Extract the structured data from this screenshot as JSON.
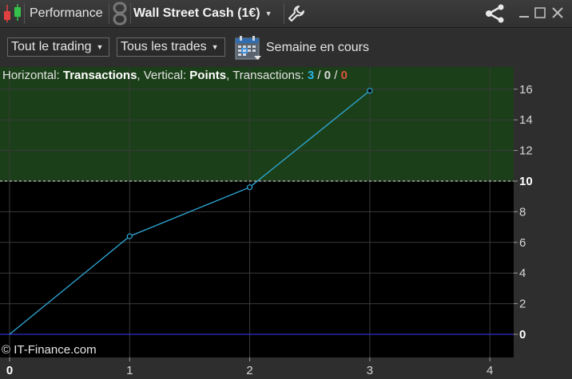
{
  "titlebar": {
    "title": "Performance",
    "instrument": "Wall Street Cash (1€)"
  },
  "toolbar": {
    "trading_filter": "Tout le trading",
    "trades_filter": "Tous les trades",
    "period": "Semaine en cours"
  },
  "info": {
    "horizontal_label": "Horizontal:",
    "horizontal_value": "Transactions",
    "vertical_label": ", Vertical:",
    "vertical_value": "Points",
    "transactions_label": ", Transactions:",
    "count_winning": "3",
    "slash1": " / ",
    "count_neutral": "0",
    "slash2": " / ",
    "count_losing": "0"
  },
  "copyright": "© IT-Finance.com",
  "colors": {
    "positive_zone": "#1b3f18",
    "line": "#2fa8d8",
    "zero_line": "#2d2dd0",
    "background": "#000000"
  },
  "icons": [
    "candlestick-icon",
    "link-icon",
    "wrench-icon",
    "share-icon",
    "minimize-icon",
    "maximize-icon",
    "close-icon",
    "calendar-icon"
  ],
  "chart_data": {
    "type": "line",
    "x": [
      0,
      1,
      2,
      3
    ],
    "y": [
      0,
      6.4,
      9.6,
      15.9
    ],
    "xlim": [
      0,
      4.2
    ],
    "ylim": [
      -1.5,
      17
    ],
    "x_ticks": [
      "0",
      "1",
      "2",
      "3",
      "4"
    ],
    "y_ticks": [
      "0",
      "2",
      "4",
      "6",
      "8",
      "10",
      "12",
      "14",
      "16"
    ],
    "threshold": 10,
    "grid": true
  }
}
